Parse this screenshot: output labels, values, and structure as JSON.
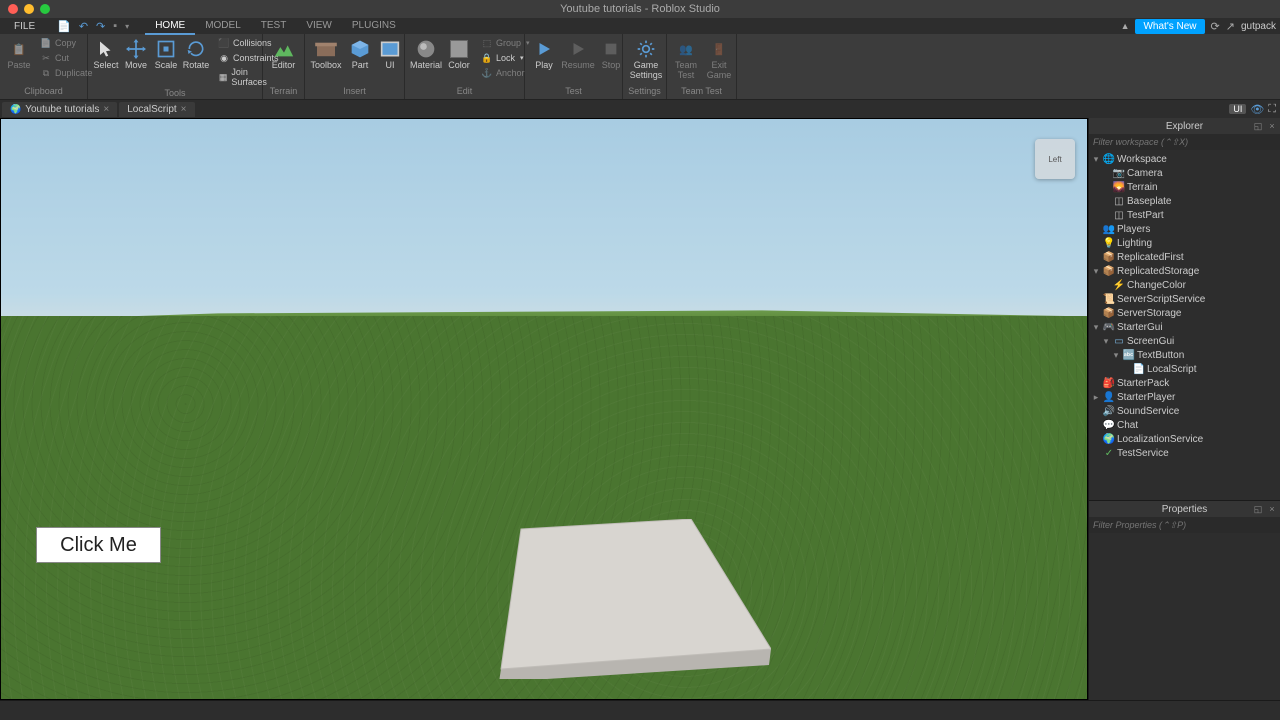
{
  "title": "Youtube tutorials - Roblox Studio",
  "file_label": "FILE",
  "tabs": [
    "HOME",
    "MODEL",
    "TEST",
    "VIEW",
    "PLUGINS"
  ],
  "whatsnew": "What's New",
  "username": "gutpack",
  "ribbon": {
    "clipboard": {
      "label": "Clipboard",
      "paste": "Paste",
      "copy": "Copy",
      "cut": "Cut",
      "duplicate": "Duplicate"
    },
    "tools": {
      "label": "Tools",
      "select": "Select",
      "move": "Move",
      "scale": "Scale",
      "rotate": "Rotate",
      "collisions": "Collisions",
      "constraints": "Constraints",
      "join": "Join Surfaces"
    },
    "terrain": {
      "label": "Terrain",
      "editor": "Editor"
    },
    "insert": {
      "label": "Insert",
      "toolbox": "Toolbox",
      "part": "Part",
      "ui": "UI"
    },
    "edit": {
      "label": "Edit",
      "material": "Material",
      "color": "Color",
      "group": "Group",
      "lock": "Lock",
      "anchor": "Anchor"
    },
    "test": {
      "label": "Test",
      "play": "Play",
      "resume": "Resume",
      "stop": "Stop"
    },
    "settings": {
      "label": "Settings",
      "game_settings": "Game\nSettings"
    },
    "teamtest": {
      "label": "Team Test",
      "team_test": "Team\nTest",
      "exit_game": "Exit\nGame"
    }
  },
  "doc_tabs": [
    {
      "icon": "🌍",
      "label": "Youtube tutorials"
    },
    {
      "icon": "",
      "label": "LocalScript"
    }
  ],
  "ui_pill": "UI",
  "explorer": {
    "title": "Explorer",
    "filter_placeholder": "Filter workspace (⌃⇧X)",
    "items": [
      {
        "d": 0,
        "tw": "▾",
        "icon": "🌐",
        "color": "#4cc2ff",
        "label": "Workspace"
      },
      {
        "d": 1,
        "tw": "",
        "icon": "📷",
        "color": "#ccc",
        "label": "Camera"
      },
      {
        "d": 1,
        "tw": "",
        "icon": "🌄",
        "color": "#5fb85f",
        "label": "Terrain"
      },
      {
        "d": 1,
        "tw": "",
        "icon": "◫",
        "color": "#bbb",
        "label": "Baseplate"
      },
      {
        "d": 1,
        "tw": "",
        "icon": "◫",
        "color": "#bbb",
        "label": "TestPart"
      },
      {
        "d": 0,
        "tw": "",
        "icon": "👥",
        "color": "#f5c542",
        "label": "Players"
      },
      {
        "d": 0,
        "tw": "",
        "icon": "💡",
        "color": "#f5e642",
        "label": "Lighting"
      },
      {
        "d": 0,
        "tw": "",
        "icon": "📦",
        "color": "#e07b7b",
        "label": "ReplicatedFirst"
      },
      {
        "d": 0,
        "tw": "▾",
        "icon": "📦",
        "color": "#e07b7b",
        "label": "ReplicatedStorage"
      },
      {
        "d": 1,
        "tw": "",
        "icon": "⚡",
        "color": "#f5c542",
        "label": "ChangeColor"
      },
      {
        "d": 0,
        "tw": "",
        "icon": "📜",
        "color": "#7bb5e0",
        "label": "ServerScriptService"
      },
      {
        "d": 0,
        "tw": "",
        "icon": "📦",
        "color": "#888",
        "label": "ServerStorage"
      },
      {
        "d": 0,
        "tw": "▾",
        "icon": "🎮",
        "color": "#f5c542",
        "label": "StarterGui"
      },
      {
        "d": 1,
        "tw": "▾",
        "icon": "▭",
        "color": "#7bb5e0",
        "label": "ScreenGui"
      },
      {
        "d": 2,
        "tw": "▾",
        "icon": "🔤",
        "color": "#ccc",
        "label": "TextButton"
      },
      {
        "d": 3,
        "tw": "",
        "icon": "📄",
        "color": "#7bb5e0",
        "label": "LocalScript"
      },
      {
        "d": 0,
        "tw": "",
        "icon": "🎒",
        "color": "#f5c542",
        "label": "StarterPack"
      },
      {
        "d": 0,
        "tw": "▸",
        "icon": "👤",
        "color": "#f5c542",
        "label": "StarterPlayer"
      },
      {
        "d": 0,
        "tw": "",
        "icon": "🔊",
        "color": "#7bb5e0",
        "label": "SoundService"
      },
      {
        "d": 0,
        "tw": "",
        "icon": "💬",
        "color": "#7bb5e0",
        "label": "Chat"
      },
      {
        "d": 0,
        "tw": "",
        "icon": "🌍",
        "color": "#5fb85f",
        "label": "LocalizationService"
      },
      {
        "d": 0,
        "tw": "",
        "icon": "✓",
        "color": "#5fb85f",
        "label": "TestService"
      }
    ]
  },
  "properties": {
    "title": "Properties",
    "filter_placeholder": "Filter Properties (⌃⇧P)"
  },
  "viewport": {
    "button_label": "Click Me",
    "cube_face": "Left"
  }
}
